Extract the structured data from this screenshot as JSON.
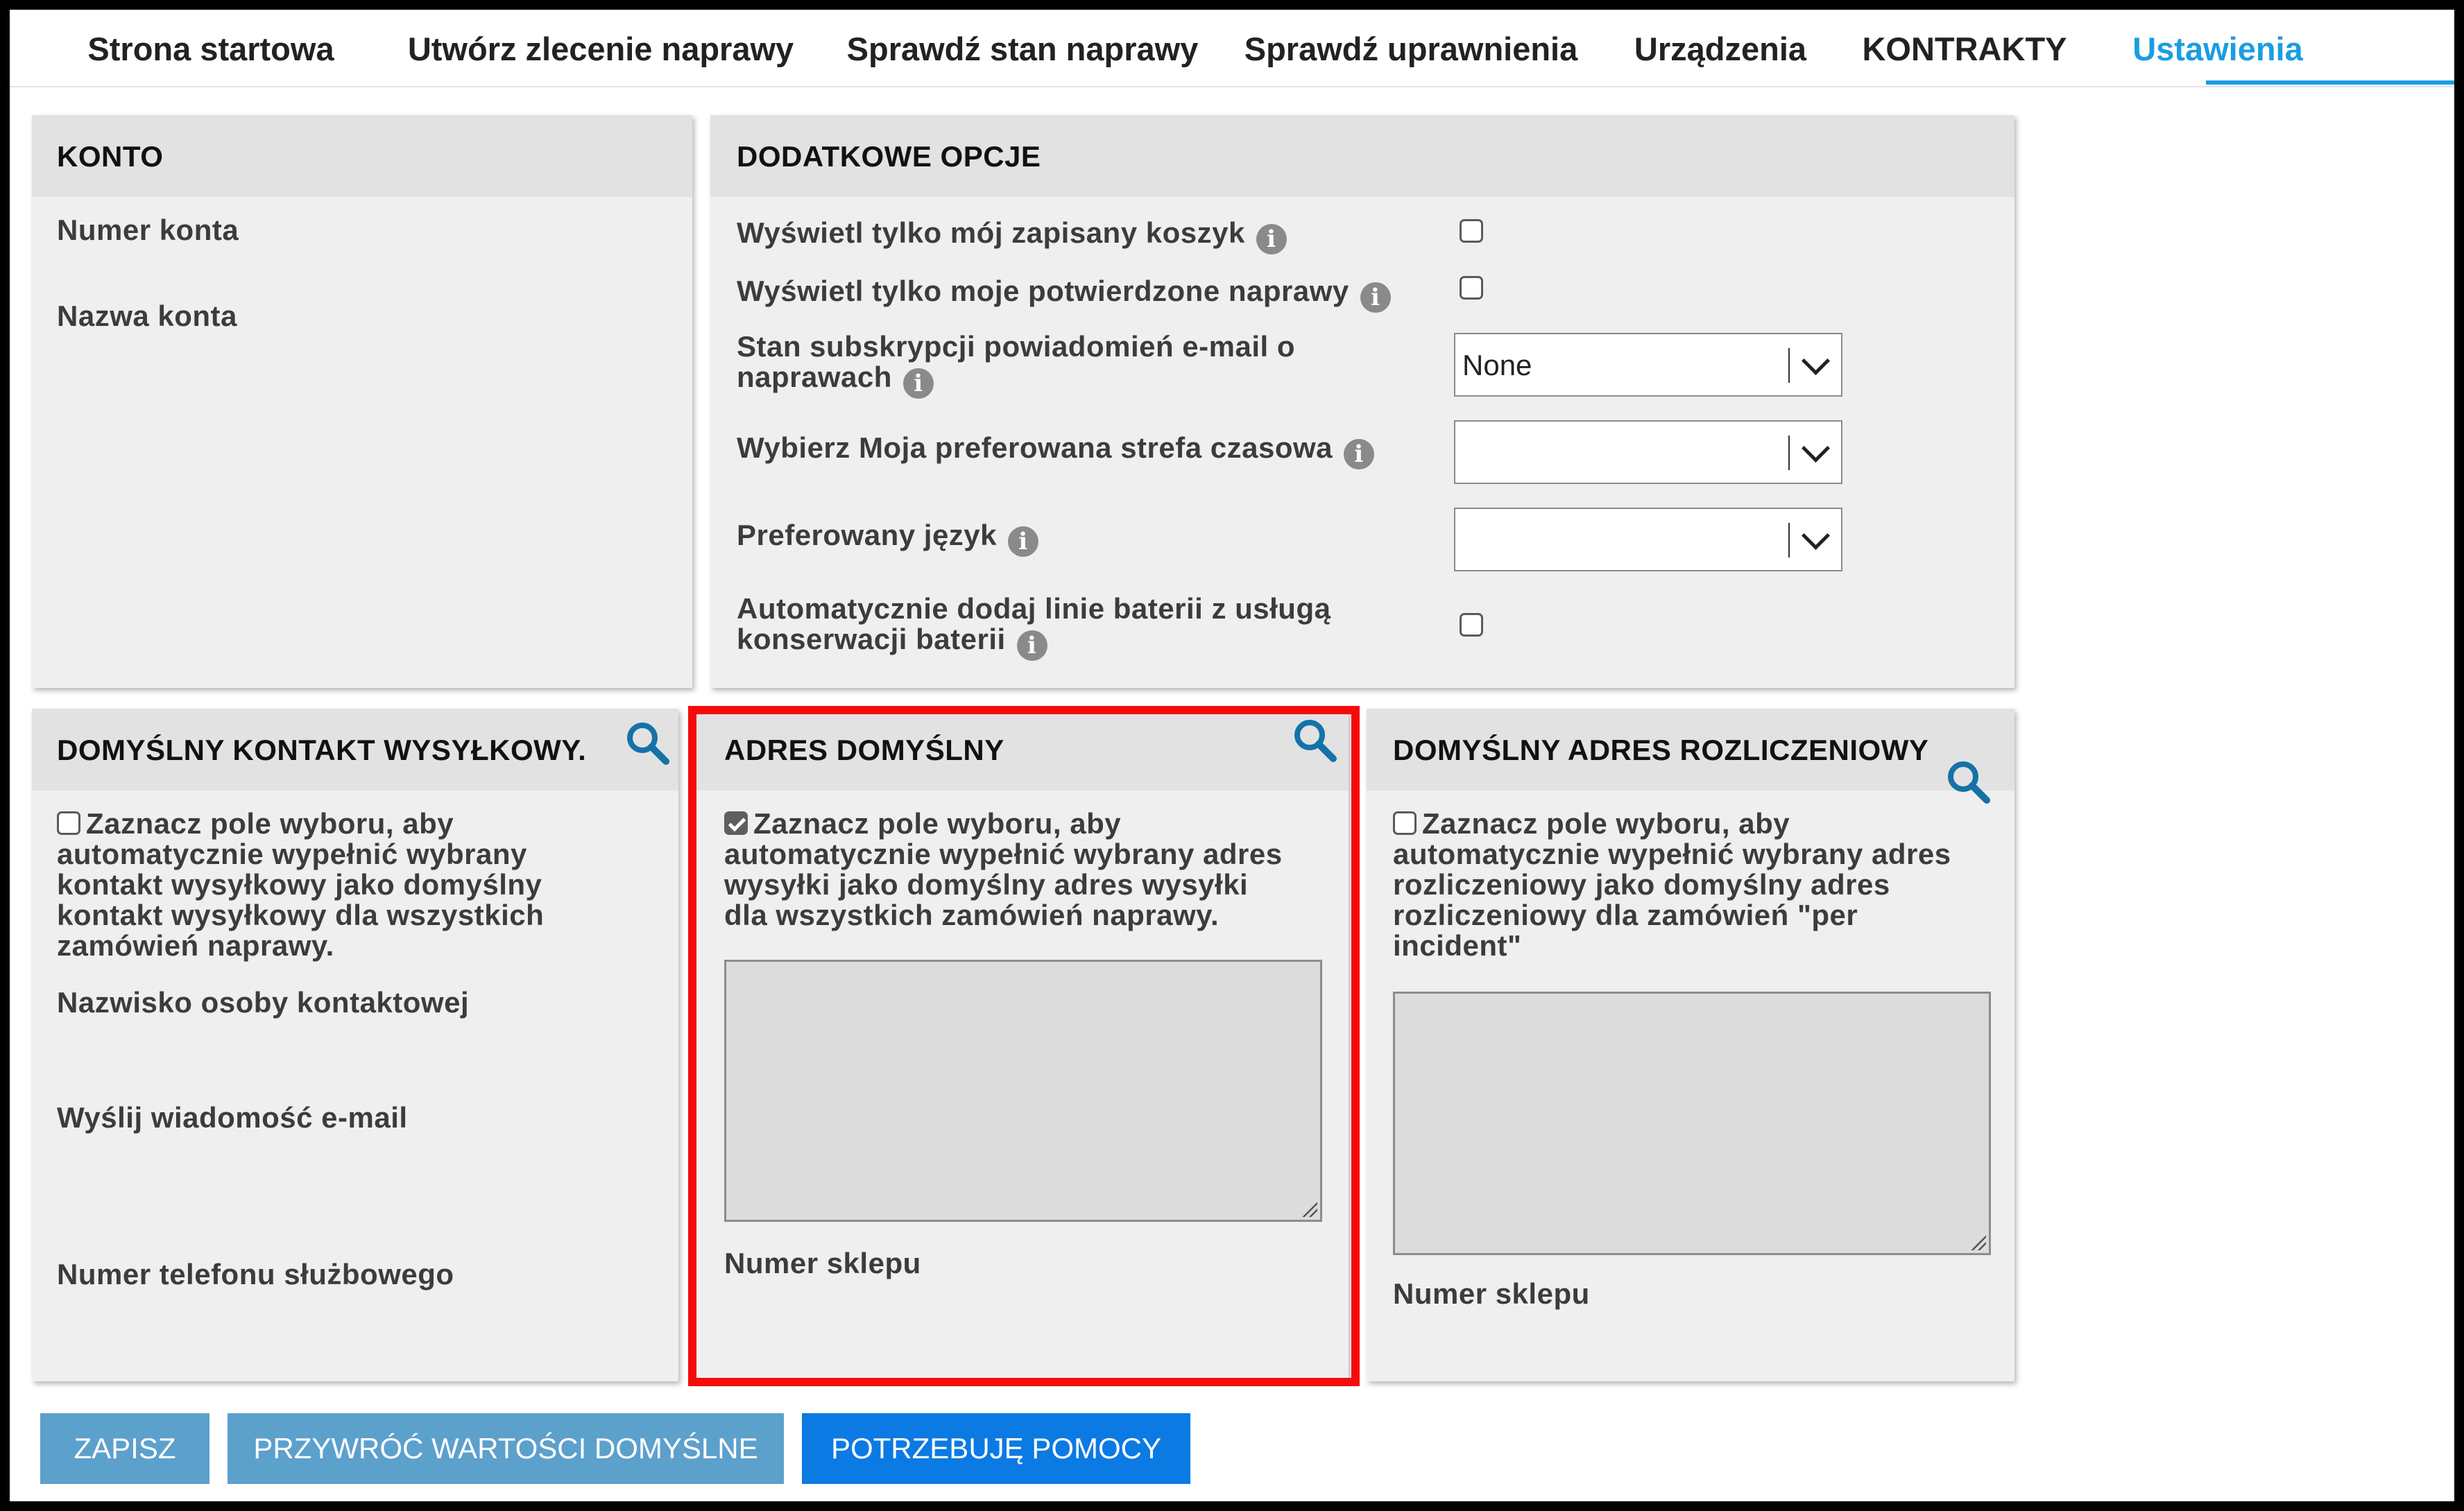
{
  "nav": {
    "tabs": [
      {
        "label": "Strona startowa"
      },
      {
        "label": "Utwórz zlecenie naprawy"
      },
      {
        "label": "Sprawdź stan naprawy"
      },
      {
        "label": "Sprawdź uprawnienia"
      },
      {
        "label": "Urządzenia"
      },
      {
        "label": "KONTRAKTY"
      },
      {
        "label": "Ustawienia",
        "active": true
      }
    ]
  },
  "konto": {
    "title": "KONTO",
    "numer_konta": "Numer konta",
    "nazwa_konta": "Nazwa konta"
  },
  "options": {
    "title": "DODATKOWE OPCJE",
    "saved_cart": {
      "label": "Wyświetl tylko mój zapisany koszyk",
      "checked": false
    },
    "confirmed_repairs": {
      "label": "Wyświetl tylko moje potwierdzone naprawy",
      "checked": false
    },
    "email_subscription": {
      "label_line1": "Stan subskrypcji powiadomień e-mail o",
      "label_line2": "naprawach",
      "value": "None"
    },
    "timezone": {
      "label": "Wybierz Moja preferowana strefa czasowa",
      "value": ""
    },
    "language": {
      "label": "Preferowany język",
      "value": ""
    },
    "battery": {
      "label_line1": "Automatycznie dodaj linie baterii z usługą",
      "label_line2": "konserwacji baterii",
      "checked": false
    }
  },
  "shipping_contact": {
    "title": "DOMYŚLNY KONTAKT WYSYŁKOWY.",
    "checkbox_checked": false,
    "checkbox_text": [
      "Zaznacz pole wyboru, aby",
      "automatycznie wypełnić wybrany",
      "kontakt wysyłkowy jako domyślny",
      "kontakt wysyłkowy dla wszystkich",
      "zamówień naprawy."
    ],
    "contact_name": "Nazwisko osoby kontaktowej",
    "send_email": "Wyślij wiadomość e-mail",
    "work_phone": "Numer telefonu służbowego"
  },
  "default_address": {
    "title": "ADRES DOMYŚLNY",
    "checkbox_checked": true,
    "checkbox_text": [
      "Zaznacz pole wyboru, aby",
      "automatycznie wypełnić wybrany adres",
      "wysyłki jako domyślny adres wysyłki",
      "dla wszystkich zamówień naprawy."
    ],
    "store_number": "Numer sklepu"
  },
  "billing_address": {
    "title": "DOMYŚLNY ADRES ROZLICZENIOWY",
    "checkbox_checked": false,
    "checkbox_text": [
      "Zaznacz pole wyboru, aby",
      "automatycznie wypełnić wybrany adres",
      "rozliczeniowy jako domyślny adres",
      "rozliczeniowy dla zamówień \"per",
      "incident\""
    ],
    "store_number": "Numer sklepu"
  },
  "buttons": {
    "save": "ZAPISZ",
    "restore": "PRZYWRÓĆ WARTOŚCI DOMYŚLNE",
    "help": "POTRZEBUJĘ POMOCY"
  },
  "colors": {
    "accent": "#1b9de2",
    "button_muted": "#5ca0cc",
    "button_primary": "#0b7ae3",
    "highlight": "#f60b0b",
    "info_icon": "#8a8a8a",
    "search_icon": "#1572a8"
  }
}
